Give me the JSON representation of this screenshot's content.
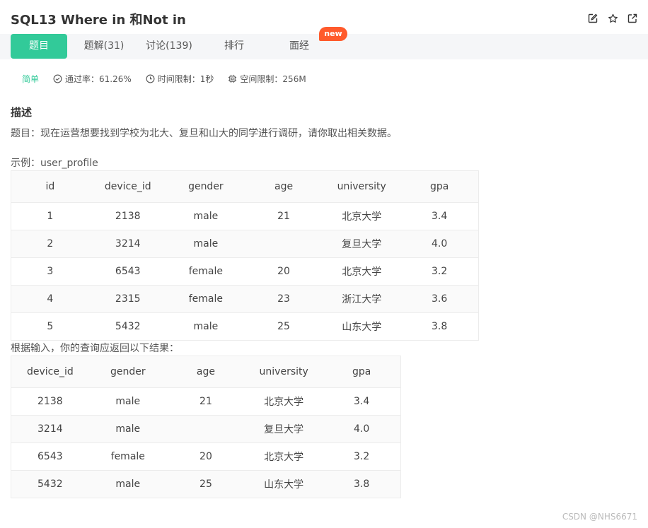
{
  "header": {
    "title": "SQL13  Where in 和Not in"
  },
  "tabs": [
    {
      "label": "题目"
    },
    {
      "label": "题解(31)"
    },
    {
      "label": "讨论(139)"
    },
    {
      "label": "排行"
    },
    {
      "label": "面经"
    }
  ],
  "badge": "new",
  "meta": {
    "difficulty": "简单",
    "pass_rate": "通过率：61.26%",
    "time_limit": "时间限制：1秒",
    "space_limit": "空间限制：256M"
  },
  "description": {
    "heading": "描述",
    "text": "题目：现在运营想要找到学校为北大、复旦和山大的同学进行调研，请你取出相关数据。",
    "example_label": "示例：user_profile",
    "result_label": "根据输入，你的查询应返回以下结果："
  },
  "table1": {
    "headers": [
      "id",
      "device_id",
      "gender",
      "age",
      "university",
      "gpa"
    ],
    "rows": [
      [
        "1",
        "2138",
        "male",
        "21",
        "北京大学",
        "3.4"
      ],
      [
        "2",
        "3214",
        "male",
        "",
        "复旦大学",
        "4.0"
      ],
      [
        "3",
        "6543",
        "female",
        "20",
        "北京大学",
        "3.2"
      ],
      [
        "4",
        "2315",
        "female",
        "23",
        "浙江大学",
        "3.6"
      ],
      [
        "5",
        "5432",
        "male",
        "25",
        "山东大学",
        "3.8"
      ]
    ]
  },
  "table2": {
    "headers": [
      "device_id",
      "gender",
      "age",
      "university",
      "gpa"
    ],
    "rows": [
      [
        "2138",
        "male",
        "21",
        "北京大学",
        "3.4"
      ],
      [
        "3214",
        "male",
        "",
        "复旦大学",
        "4.0"
      ],
      [
        "6543",
        "female",
        "20",
        "北京大学",
        "3.2"
      ],
      [
        "5432",
        "male",
        "25",
        "山东大学",
        "3.8"
      ]
    ]
  },
  "watermark": "CSDN @NHS6671",
  "icons": [
    "edit-icon",
    "star-icon",
    "share-icon",
    "check-circle-icon",
    "clock-icon",
    "chip-icon"
  ],
  "colors": {
    "accent": "#32ca99",
    "badge": "#ff5a2c"
  }
}
